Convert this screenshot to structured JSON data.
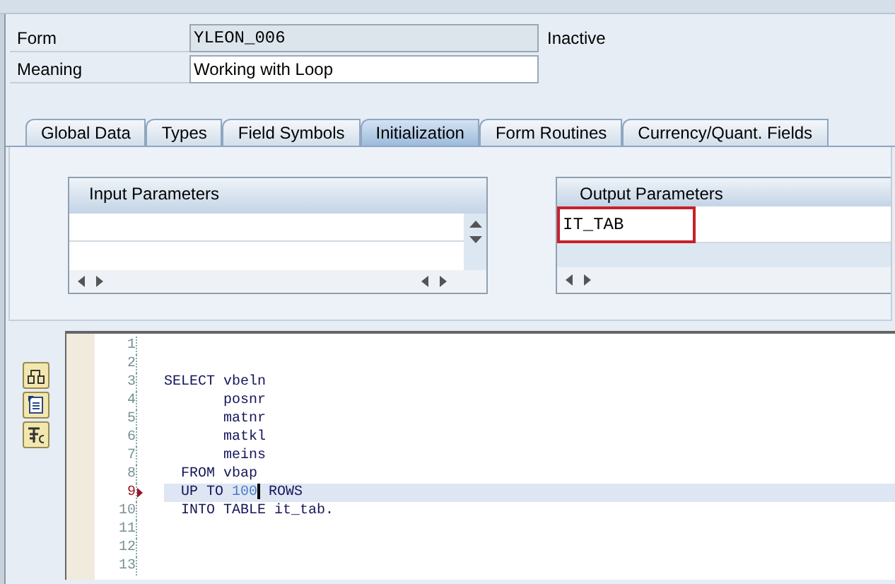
{
  "header": {
    "fields": [
      {
        "label": "Form",
        "value": "YLEON_006",
        "kind": "readonly",
        "status": "Inactive"
      },
      {
        "label": "Meaning",
        "value": "Working with Loop",
        "kind": "editable"
      }
    ]
  },
  "tabs": [
    {
      "label": "Global Data",
      "selected": false
    },
    {
      "label": "Types",
      "selected": false
    },
    {
      "label": "Field Symbols",
      "selected": false
    },
    {
      "label": "Initialization",
      "selected": true
    },
    {
      "label": "Form Routines",
      "selected": false
    },
    {
      "label": "Currency/Quant. Fields",
      "selected": false
    }
  ],
  "input_parameters": {
    "title": "Input Parameters"
  },
  "output_parameters": {
    "title": "Output Parameters",
    "rows": [
      "IT_TAB"
    ]
  },
  "editor": {
    "lines": [
      {
        "number": "1",
        "current": false
      },
      {
        "number": "2",
        "current": false
      },
      {
        "number": "3",
        "current": false,
        "tokens": [
          {
            "kind": "plain",
            "text": "SELECT vbeln"
          }
        ]
      },
      {
        "number": "4",
        "current": false,
        "tokens": [
          {
            "kind": "plain",
            "text": "       posnr"
          }
        ]
      },
      {
        "number": "5",
        "current": false,
        "tokens": [
          {
            "kind": "plain",
            "text": "       matnr"
          }
        ]
      },
      {
        "number": "6",
        "current": false,
        "tokens": [
          {
            "kind": "plain",
            "text": "       matkl"
          }
        ]
      },
      {
        "number": "7",
        "current": false,
        "tokens": [
          {
            "kind": "plain",
            "text": "       meins"
          }
        ]
      },
      {
        "number": "8",
        "current": false,
        "tokens": [
          {
            "kind": "plain",
            "text": "  FROM vbap"
          }
        ]
      },
      {
        "number": "9",
        "current": true,
        "tokens": [
          {
            "kind": "plain",
            "text": "  UP TO "
          },
          {
            "kind": "number",
            "text": "100"
          },
          {
            "kind": "cursor"
          },
          {
            "kind": "plain",
            "text": " ROWS"
          }
        ]
      },
      {
        "number": "10",
        "current": false,
        "tokens": [
          {
            "kind": "plain",
            "text": "  INTO TABLE it_tab."
          }
        ]
      },
      {
        "number": "11",
        "current": false
      },
      {
        "number": "12",
        "current": false
      },
      {
        "number": "13",
        "current": false
      }
    ]
  }
}
